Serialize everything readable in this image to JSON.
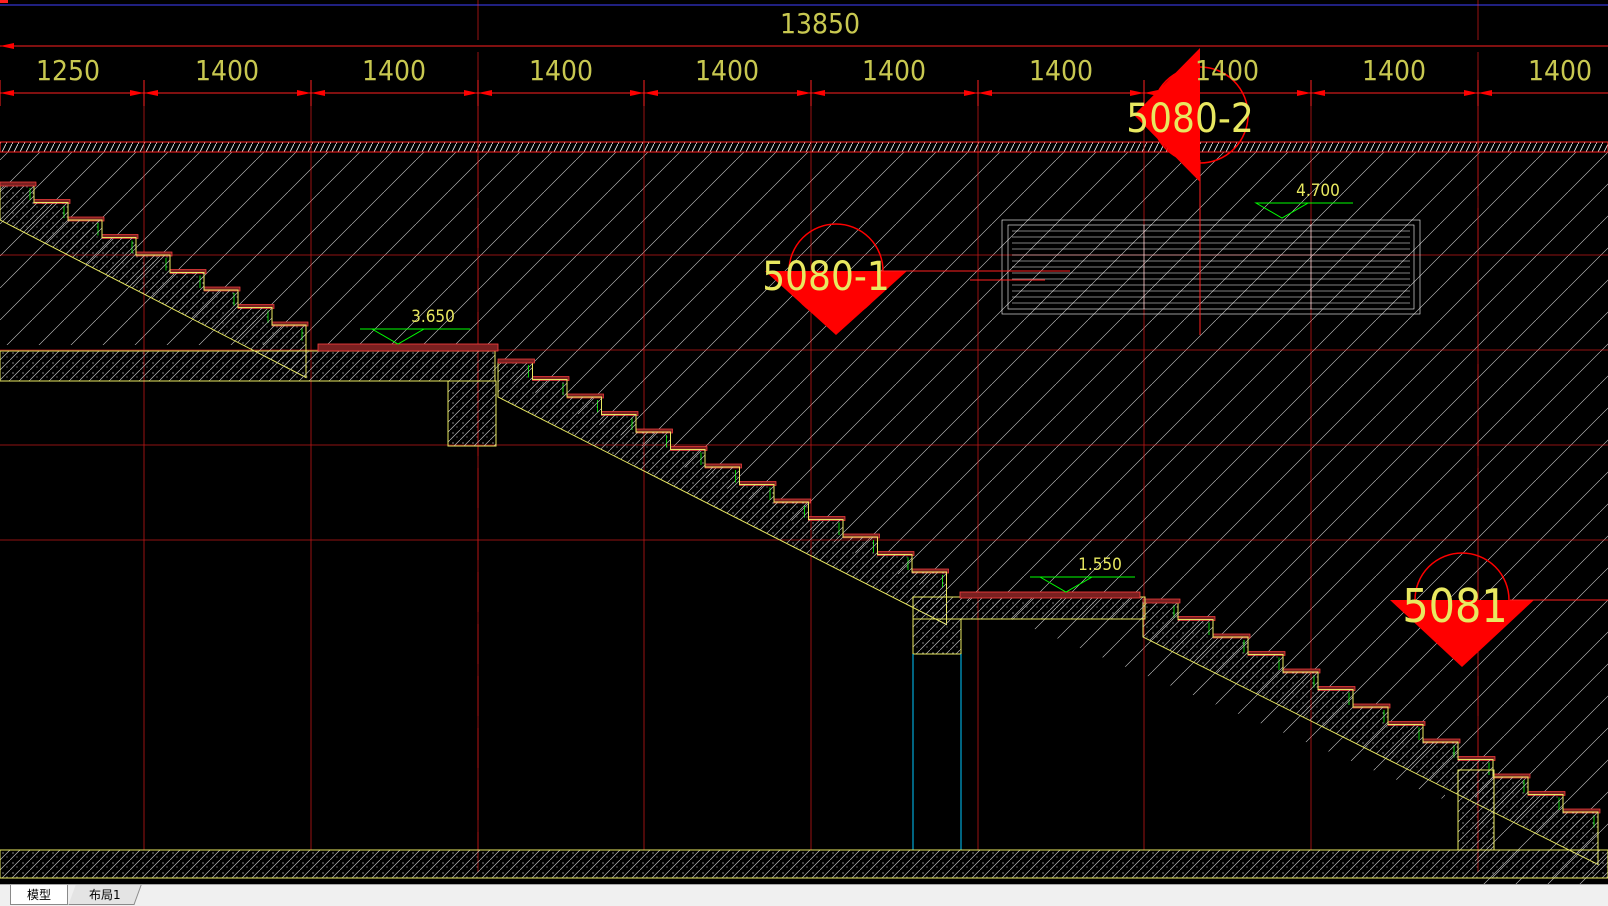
{
  "drawing": {
    "overall_dimension": "13850",
    "segment_dimensions": [
      "1250",
      "1400",
      "1400",
      "1400",
      "1400",
      "1400",
      "1400",
      "1400",
      "1400",
      "1400"
    ],
    "elevations": {
      "left_landing": "3.650",
      "right_landing": "1.550",
      "upper": "4.700"
    },
    "section_markers": {
      "marker_1": "5080-1",
      "marker_2": "5080-2",
      "marker_3": "5081"
    },
    "colors": {
      "background": "#000000",
      "grid": "#ff2020",
      "dimension_text": "#c8c850",
      "outline": "#e8e860",
      "marker": "#ff0000",
      "elevation": "#00ff00",
      "hatch": "#ffffff",
      "cyan": "#00c8ff",
      "blue_line": "#4040ff"
    }
  },
  "tabs": {
    "model": "模型",
    "layout1": "布局1"
  }
}
